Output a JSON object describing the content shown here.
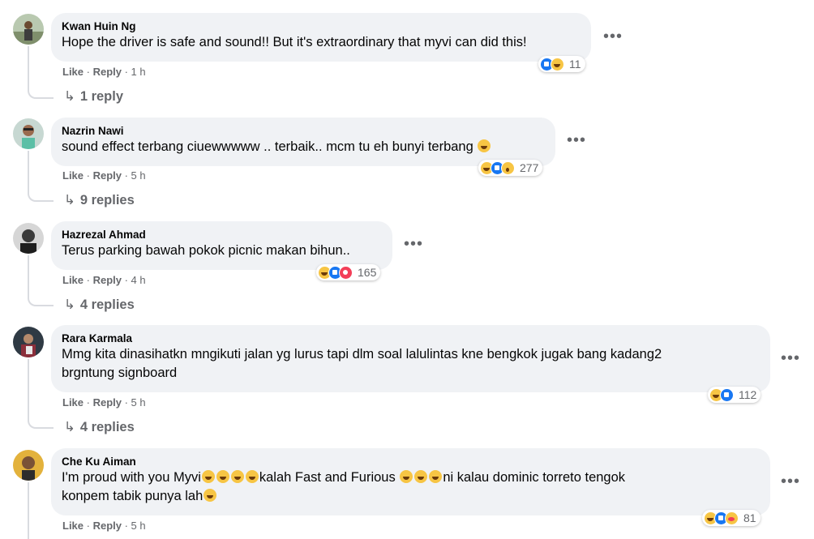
{
  "comments": [
    {
      "author": "Kwan Huin Ng",
      "text": "Hope the driver is safe and sound!! But it's extraordinary that myvi can did this!",
      "like": "Like",
      "reply": "Reply",
      "time": "1 h",
      "reaction_count": "11",
      "reactions": [
        "like-icon",
        "haha-icon"
      ],
      "replies": "1 reply"
    },
    {
      "author": "Nazrin Nawi",
      "text": "sound effect terbang ciuewwwww .. terbaik.. mcm tu eh bunyi terbang",
      "like": "Like",
      "reply": "Reply",
      "time": "5 h",
      "reaction_count": "277",
      "reactions": [
        "haha-icon",
        "like-icon",
        "wow-icon"
      ],
      "replies": "9 replies"
    },
    {
      "author": "Hazrezal Ahmad",
      "text": "Terus parking bawah pokok picnic makan bihun..",
      "like": "Like",
      "reply": "Reply",
      "time": "4 h",
      "reaction_count": "165",
      "reactions": [
        "haha-icon",
        "like-icon",
        "love-icon"
      ],
      "replies": "4 replies"
    },
    {
      "author": "Rara Karmala",
      "text_line1": "Mmg kita dinasihatkn mngikuti jalan yg lurus tapi dlm soal lalulintas kne bengkok jugak bang kadang2",
      "text_line2": "brgntung signboard",
      "like": "Like",
      "reply": "Reply",
      "time": "5 h",
      "reaction_count": "112",
      "reactions": [
        "haha-icon",
        "like-icon"
      ],
      "replies": "4 replies"
    },
    {
      "author": "Che Ku Aiman",
      "text_a": "I'm proud with you Myvi",
      "text_b": "kalah Fast and Furious",
      "text_c": "ni kalau dominic torreto tengok",
      "text_line2": "konpem tabik punya lah",
      "like": "Like",
      "reply": "Reply",
      "time": "5 h",
      "reaction_count": "81",
      "reactions": [
        "haha-icon",
        "like-icon",
        "care-icon"
      ]
    }
  ],
  "more_label": "•••",
  "reply_arrow": "↳",
  "separator": " · "
}
